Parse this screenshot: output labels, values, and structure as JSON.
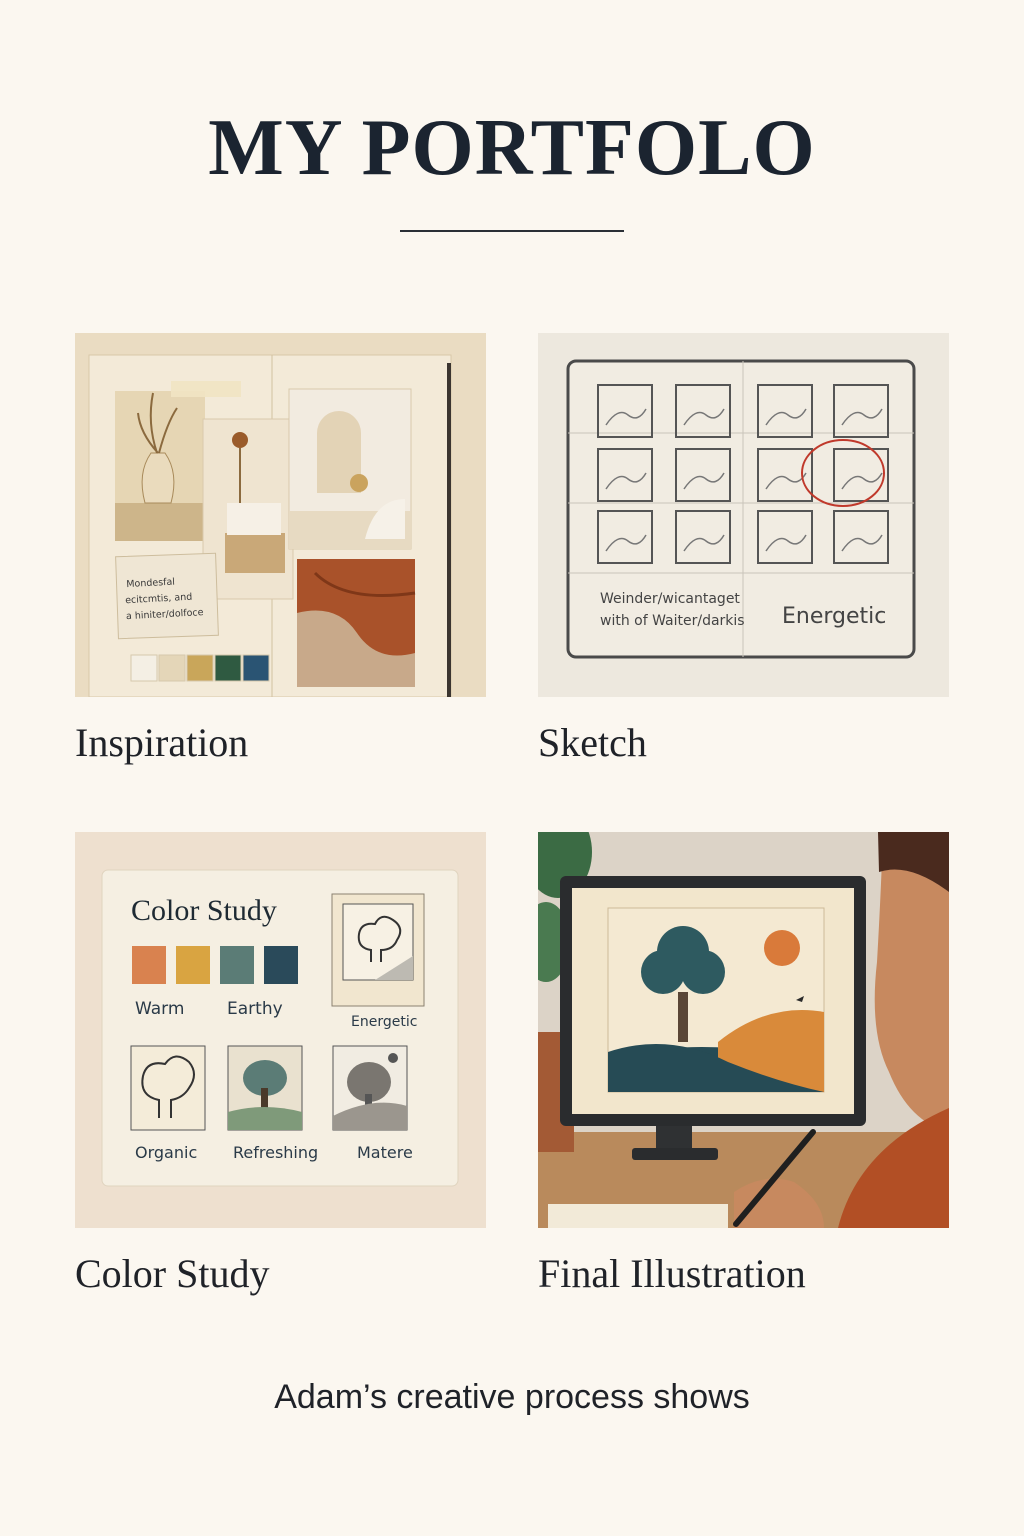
{
  "page": {
    "title": "MY PORTFOLO",
    "footer": "Adam’s creative process shows"
  },
  "cards": [
    {
      "caption": "Inspiration",
      "note_lines": [
        "Mondesfal",
        "ecitcmtis, and",
        "a hiniter/dolfoce"
      ],
      "palette": [
        "#f4efe4",
        "#e4d6b8",
        "#c9a65a",
        "#2f5a41",
        "#2a5473"
      ]
    },
    {
      "caption": "Sketch",
      "note_lines": [
        "Weinder/wicantaget",
        "with of Waiter/darkis"
      ],
      "word": "Energetic"
    },
    {
      "caption": "Color Study",
      "heading": "Color Study",
      "swatches": [
        "#d9824f",
        "#d9a441",
        "#5b7c76",
        "#2a4a5a"
      ],
      "labels": [
        "Warm",
        "Earthy",
        "Energetic",
        "Organic",
        "Refreshing",
        "Matere"
      ]
    },
    {
      "caption": "Final Illustration"
    }
  ],
  "icons": [
    "monitor-icon",
    "tree-icon",
    "sun-icon",
    "pen-icon",
    "plant-icon"
  ]
}
